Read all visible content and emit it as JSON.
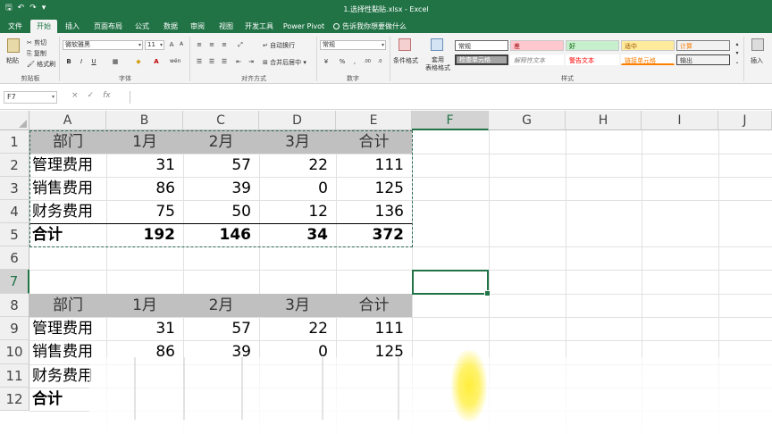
{
  "window": {
    "title": "1.选择性黏贴.xlsx  -  Excel"
  },
  "tabs": [
    {
      "label": "文件"
    },
    {
      "label": "开始"
    },
    {
      "label": "插入"
    },
    {
      "label": "页面布局"
    },
    {
      "label": "公式"
    },
    {
      "label": "数据"
    },
    {
      "label": "审阅"
    },
    {
      "label": "视图"
    },
    {
      "label": "开发工具"
    },
    {
      "label": "Power Pivot"
    },
    {
      "label": "告诉我你想要做什么"
    }
  ],
  "ribbon": {
    "clipboard": {
      "paste": "粘贴",
      "cut": "剪切",
      "copy": "复制",
      "format_painter": "格式刷",
      "label": "剪贴板"
    },
    "font": {
      "name": "微软雅黑",
      "size": "11",
      "bold": "B",
      "italic": "I",
      "underline": "U",
      "label": "字体"
    },
    "alignment": {
      "wrap": "自动换行",
      "merge": "合并后居中",
      "label": "对齐方式"
    },
    "number": {
      "format": "常规",
      "percent": "%",
      "comma": ",",
      "label": "数字"
    },
    "styles": {
      "conditional": "条件格式",
      "table": "套用\n表格格式",
      "cells": [
        {
          "text": "常规"
        },
        {
          "text": "差"
        },
        {
          "text": "好"
        },
        {
          "text": "适中"
        },
        {
          "text": "计算"
        },
        {
          "text": "检查单元格"
        },
        {
          "text": "解释性文本"
        },
        {
          "text": "警告文本"
        },
        {
          "text": "链接单元格"
        },
        {
          "text": "输出"
        }
      ],
      "label": "样式"
    },
    "insert": "插入"
  },
  "formula_bar": {
    "name_box": "F7",
    "cancel": "×",
    "enter": "✓",
    "fx": "fx",
    "value": ""
  },
  "grid": {
    "columns": [
      "A",
      "B",
      "C",
      "D",
      "E",
      "F",
      "G",
      "H",
      "I",
      "J"
    ],
    "rows": [
      "1",
      "2",
      "3",
      "4",
      "5",
      "6",
      "7",
      "8",
      "9",
      "10",
      "11",
      "12"
    ],
    "table1": {
      "header": [
        "部门",
        "1月",
        "2月",
        "3月",
        "合计"
      ],
      "rows": [
        [
          "管理费用",
          "31",
          "57",
          "22",
          "111"
        ],
        [
          "销售费用",
          "86",
          "39",
          "0",
          "125"
        ],
        [
          "财务费用",
          "75",
          "50",
          "12",
          "136"
        ],
        [
          "合计",
          "192",
          "146",
          "34",
          "372"
        ]
      ]
    },
    "table2": {
      "header": [
        "部门",
        "1月",
        "2月",
        "3月",
        "合计"
      ],
      "rows": [
        [
          "管理费用",
          "31",
          "57",
          "22",
          "111"
        ],
        [
          "销售费用",
          "86",
          "39",
          "0",
          "125"
        ],
        [
          "财务费用",
          "",
          "",
          "",
          ""
        ],
        [
          "合计",
          "",
          "",
          "",
          ""
        ]
      ]
    }
  },
  "colors": {
    "excel_green": "#217346",
    "header_band": "#c0c0c0",
    "style_bad_bg": "#ffc7ce",
    "style_good_bg": "#c6efce",
    "style_neutral_bg": "#ffeb9c"
  }
}
